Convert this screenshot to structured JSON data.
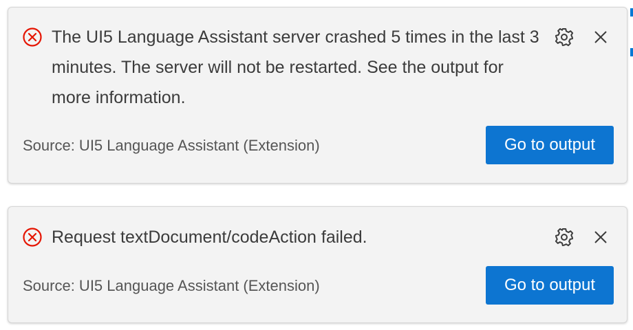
{
  "notifications": [
    {
      "severity_icon": "error-circle-icon",
      "message": "The UI5 Language Assistant server crashed 5 times in the last 3 minutes. The server will not be restarted. See the output for more information.",
      "source": "Source: UI5 Language Assistant (Extension)",
      "action_label": "Go to output",
      "settings_icon": "gear-icon",
      "close_icon": "close-icon"
    },
    {
      "severity_icon": "error-circle-icon",
      "message": "Request textDocument/codeAction failed.",
      "source": "Source: UI5 Language Assistant (Extension)",
      "action_label": "Go to output",
      "settings_icon": "gear-icon",
      "close_icon": "close-icon"
    }
  ],
  "colors": {
    "error": "#e51400",
    "primary_button": "#0d75d1",
    "toast_background": "#f3f3f3",
    "accent_edge": "#0078d4"
  }
}
